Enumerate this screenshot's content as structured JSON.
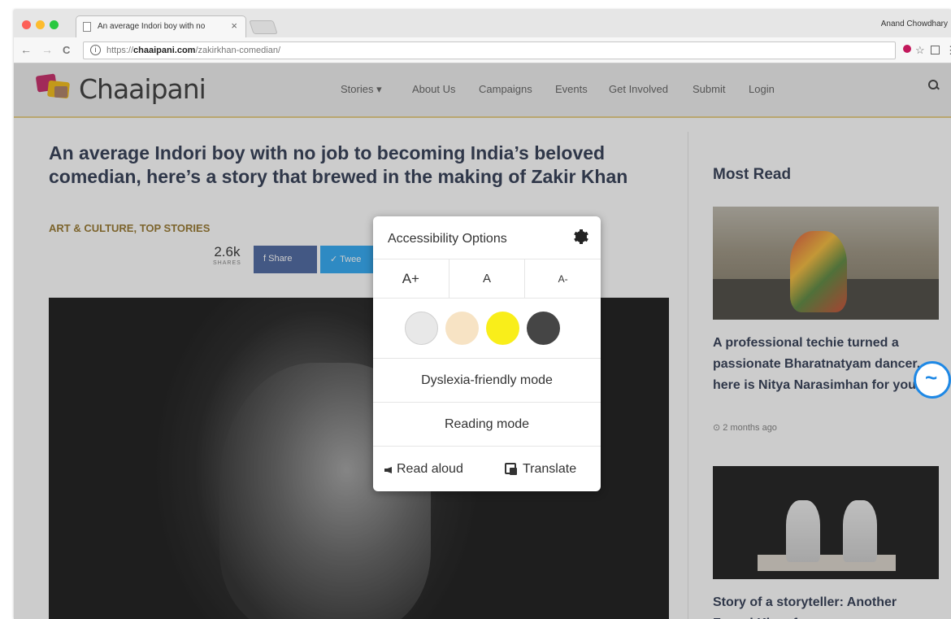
{
  "browser": {
    "tab_title": "An average Indori boy with no",
    "tab_close": "×",
    "user_name": "Anand Chowdhary",
    "url_prefix": "https://",
    "url_domain": "chaaipani.com",
    "url_path": "/zakirkhan-comedian/",
    "back": "←",
    "forward": "→",
    "reload": "C",
    "star": "☆",
    "menu": "⋮"
  },
  "site": {
    "logo_text": "Chaaipani",
    "nav": {
      "stories": "Stories ▾",
      "about": "About Us",
      "campaigns": "Campaigns",
      "events": "Events",
      "get_involved": "Get Involved",
      "submit": "Submit",
      "login": "Login"
    },
    "brand_colors": {
      "magenta": "#c2185b",
      "yellow": "#f2b600",
      "purple": "#6a3fa0"
    }
  },
  "article": {
    "title": "An average Indori boy with no job to becoming India’s beloved comedian, here’s a story that brewed in the making of Zakir Khan",
    "categories": "ART & CULTURE,  TOP STORIES",
    "share_count": "2.6k",
    "share_label": "SHARES",
    "fb_label": "f   Share",
    "tw_label": "✓  Twee"
  },
  "sidebar": {
    "heading": "Most Read",
    "card1_title": "A professional techie turned a passionate Bharatnatyam dancer, here is Nitya Narasimhan for you",
    "card1_time": "⊙ 2 months ago",
    "card2_title": "Story of a storyteller: Another Fawad Khan from"
  },
  "accessibility": {
    "title": "Accessibility Options",
    "size_increase": "A+",
    "size_normal": "A",
    "size_decrease": "A-",
    "swatch_colors": [
      "#e8e8e8",
      "#f7e3c4",
      "#f9ee1a",
      "#454545"
    ],
    "dyslexia": "Dyslexia-friendly mode",
    "reading": "Reading mode",
    "read_aloud": "Read aloud",
    "translate": "Translate"
  }
}
